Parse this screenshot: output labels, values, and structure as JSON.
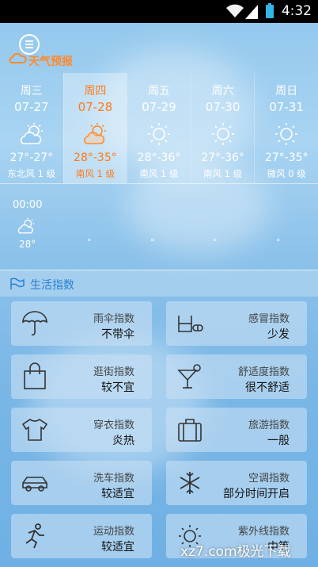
{
  "status_bar": {
    "time": "4:32"
  },
  "header": {
    "title": "天气预报"
  },
  "forecast": [
    {
      "weekday": "周三",
      "date": "07-27",
      "temp": "27°-27°",
      "wind": "东北风 1 级",
      "icon": "partly-cloudy-icon",
      "selected": false
    },
    {
      "weekday": "周四",
      "date": "07-28",
      "temp": "28°-35°",
      "wind": "南风 1 级",
      "icon": "partly-cloudy-icon",
      "selected": true
    },
    {
      "weekday": "周五",
      "date": "07-29",
      "temp": "28°-36°",
      "wind": "南风 1 级",
      "icon": "sun-icon",
      "selected": false
    },
    {
      "weekday": "周六",
      "date": "07-30",
      "temp": "27°-36°",
      "wind": "南风 1 级",
      "icon": "sun-icon",
      "selected": false
    },
    {
      "weekday": "周日",
      "date": "07-31",
      "temp": "27°-35°",
      "wind": "微风 0 级",
      "icon": "sun-icon",
      "selected": false
    }
  ],
  "hourly": {
    "time": "00:00",
    "temp": "28°",
    "placeholders": [
      "°",
      "°",
      "°",
      "°"
    ]
  },
  "life": {
    "title": "生活指数",
    "cards": [
      {
        "name": "雨伞指数",
        "value": "不带伞",
        "icon": "umbrella-icon"
      },
      {
        "name": "感冒指数",
        "value": "少发",
        "icon": "medicine-icon"
      },
      {
        "name": "逛街指数",
        "value": "较不宜",
        "icon": "shopping-bag-icon"
      },
      {
        "name": "舒适度指数",
        "value": "很不舒适",
        "icon": "cocktail-icon"
      },
      {
        "name": "穿衣指数",
        "value": "炎热",
        "icon": "shirt-icon"
      },
      {
        "name": "旅游指数",
        "value": "一般",
        "icon": "suitcase-icon"
      },
      {
        "name": "洗车指数",
        "value": "较适宜",
        "icon": "car-icon"
      },
      {
        "name": "空调指数",
        "value": "部分时间开启",
        "icon": "snowflake-icon"
      },
      {
        "name": "运动指数",
        "value": "较适宜",
        "icon": "running-icon"
      },
      {
        "name": "紫外线指数",
        "value": "中等",
        "icon": "sun-uv-icon"
      }
    ]
  },
  "watermark": "xz7.com极光下载"
}
